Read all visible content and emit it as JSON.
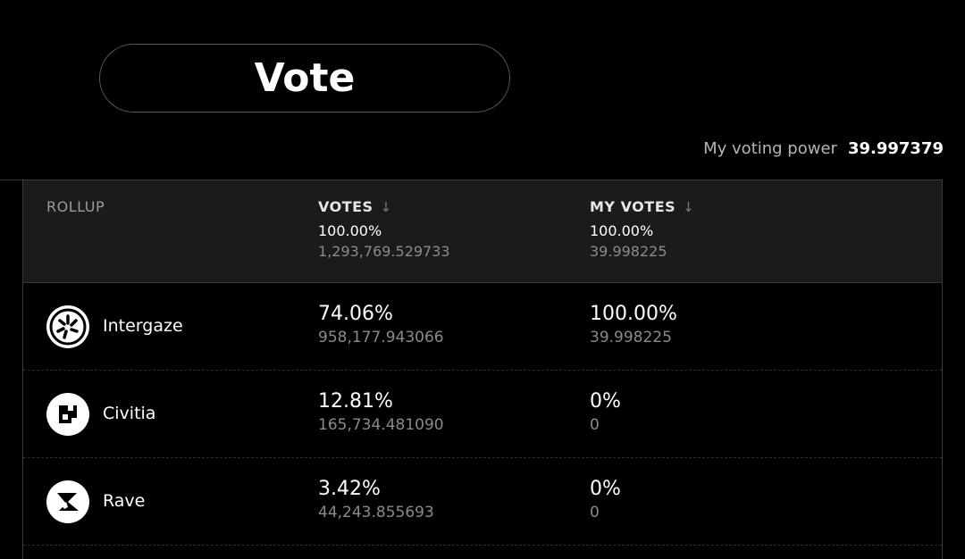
{
  "header": {
    "title": "Vote"
  },
  "voting_power": {
    "label": "My voting power",
    "value": "39.997379"
  },
  "table": {
    "columns": {
      "rollup": "ROLLUP",
      "votes": "VOTES",
      "my_votes": "MY VOTES"
    },
    "totals": {
      "votes_pct": "100.00%",
      "votes_amount": "1,293,769.529733",
      "my_votes_pct": "100.00%",
      "my_votes_amount": "39.998225"
    },
    "rows": [
      {
        "name": "Intergaze",
        "icon": "intergaze-logo-icon",
        "votes_pct": "74.06%",
        "votes_amount": "958,177.943066",
        "my_votes_pct": "100.00%",
        "my_votes_amount": "39.998225"
      },
      {
        "name": "Civitia",
        "icon": "civitia-logo-icon",
        "votes_pct": "12.81%",
        "votes_amount": "165,734.481090",
        "my_votes_pct": "0%",
        "my_votes_amount": "0"
      },
      {
        "name": "Rave",
        "icon": "rave-logo-icon",
        "votes_pct": "3.42%",
        "votes_amount": "44,243.855693",
        "my_votes_pct": "0%",
        "my_votes_amount": "0"
      }
    ]
  },
  "colors": {
    "background": "#000000",
    "header_row": "#1a1c1c",
    "muted_text": "#8a8a8a",
    "border": "#3a3a3a"
  }
}
